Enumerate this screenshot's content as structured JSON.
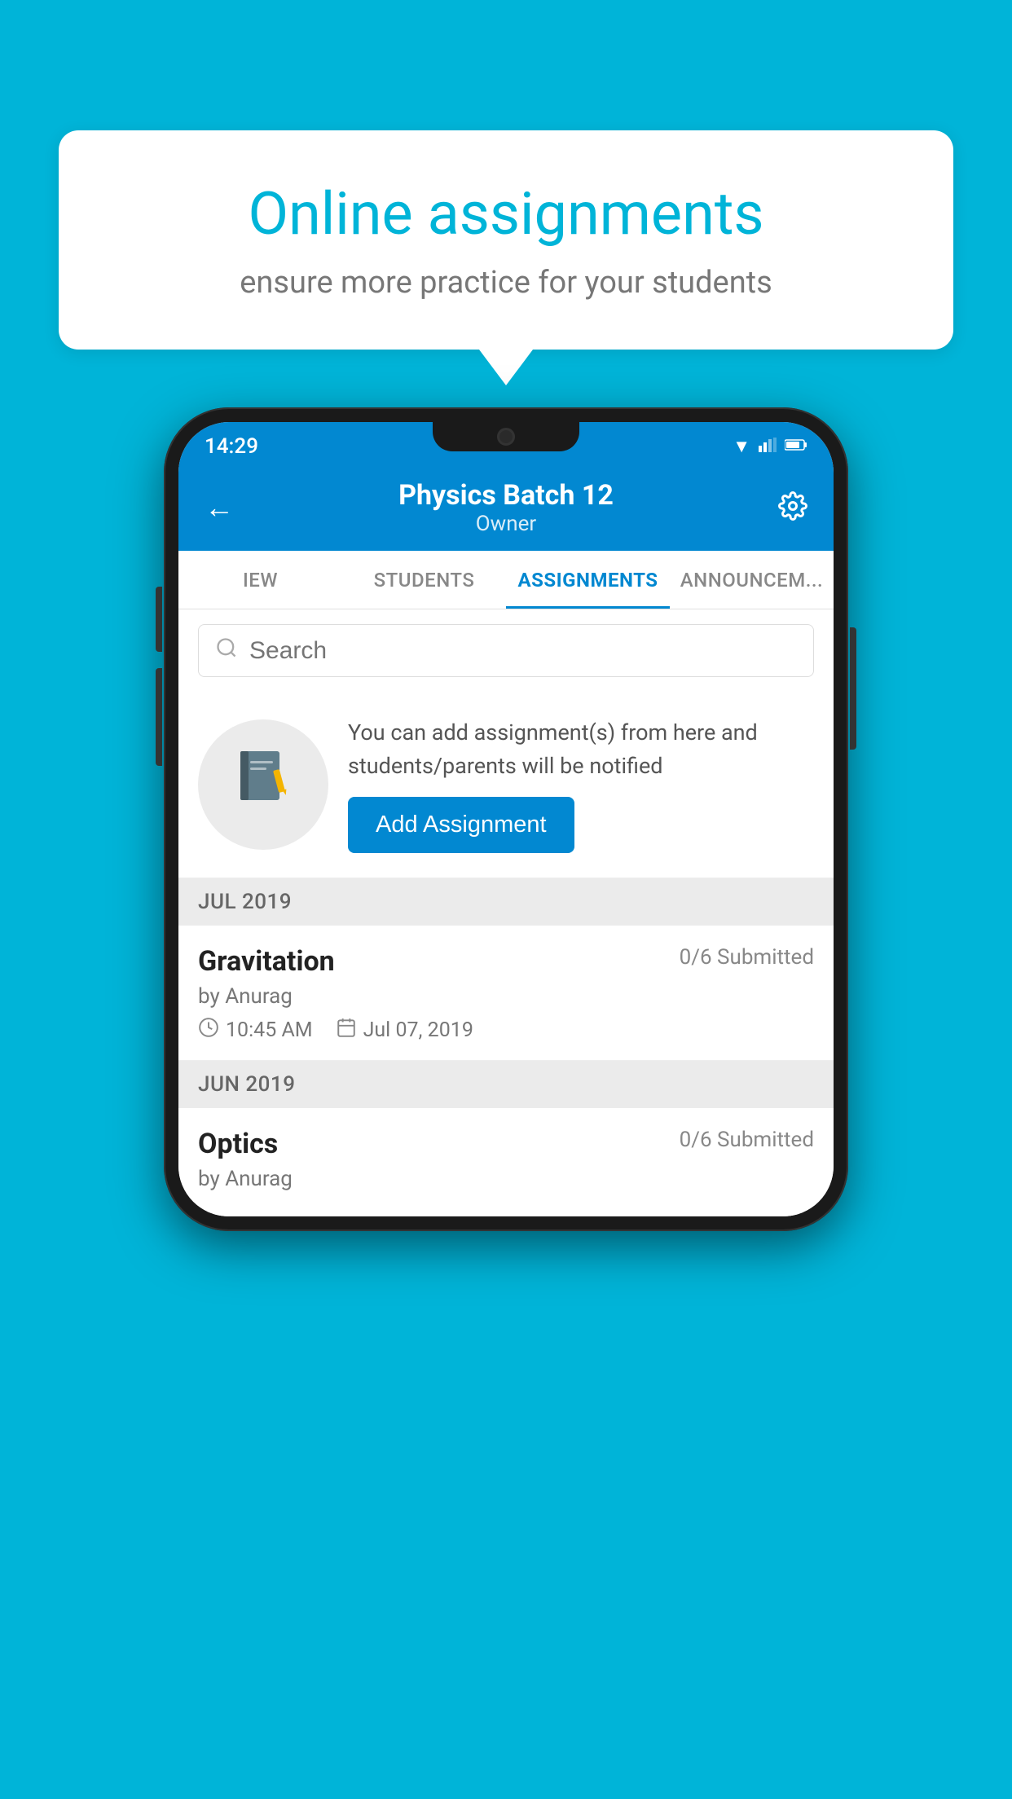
{
  "background_color": "#00b4d8",
  "speech_bubble": {
    "title": "Online assignments",
    "subtitle": "ensure more practice for your students"
  },
  "status_bar": {
    "time": "14:29",
    "wifi": "▼",
    "signal": "▲",
    "battery": "▮"
  },
  "header": {
    "title": "Physics Batch 12",
    "subtitle": "Owner",
    "back_label": "←",
    "settings_label": "⚙"
  },
  "tabs": [
    {
      "label": "IEW",
      "active": false
    },
    {
      "label": "STUDENTS",
      "active": false
    },
    {
      "label": "ASSIGNMENTS",
      "active": true
    },
    {
      "label": "ANNOUNCEM...",
      "active": false
    }
  ],
  "search": {
    "placeholder": "Search"
  },
  "add_assignment_card": {
    "description": "You can add assignment(s) from here and students/parents will be notified",
    "button_label": "Add Assignment"
  },
  "sections": [
    {
      "header": "JUL 2019",
      "items": [
        {
          "name": "Gravitation",
          "submitted": "0/6 Submitted",
          "by": "by Anurag",
          "time": "10:45 AM",
          "date": "Jul 07, 2019"
        }
      ]
    },
    {
      "header": "JUN 2019",
      "items": [
        {
          "name": "Optics",
          "submitted": "0/6 Submitted",
          "by": "by Anurag",
          "time": "",
          "date": ""
        }
      ]
    }
  ]
}
